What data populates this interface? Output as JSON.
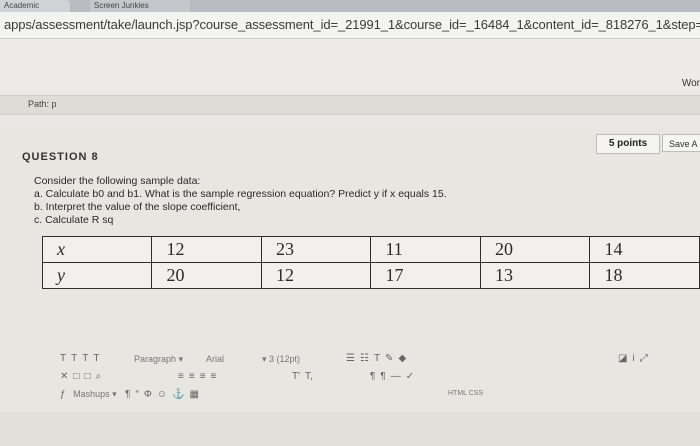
{
  "browser": {
    "tabs": [
      {
        "label": "Academic Calc",
        "close": "×"
      },
      {
        "label": "Screen Junkies"
      }
    ],
    "url": "apps/assessment/take/launch.jsp?course_assessment_id=_21991_1&course_id=_16484_1&content_id=_818276_1&step=null"
  },
  "header": {
    "right_label": "Wor"
  },
  "path": {
    "label": "Path: p"
  },
  "question": {
    "title": "QUESTION 8",
    "points": "5 points",
    "save_label": "Save A",
    "lines": [
      "Consider the following sample data:",
      "a. Calculate b0 and b1. What is the sample regression equation? Predict y if x equals 15.",
      "b. Interpret the value of the slope coefficient,",
      "c. Calculate R sq"
    ],
    "table": {
      "rows": [
        {
          "var": "x",
          "values": [
            "12",
            "23",
            "11",
            "20",
            "14"
          ]
        },
        {
          "var": "y",
          "values": [
            "20",
            "12",
            "17",
            "13",
            "18"
          ]
        }
      ]
    }
  },
  "editor": {
    "format_label": "Paragraph",
    "font_label": "Arial",
    "size_label": "3 (12pt)",
    "mashups_label": "Mashups",
    "html_css_label": "HTML CSS"
  }
}
